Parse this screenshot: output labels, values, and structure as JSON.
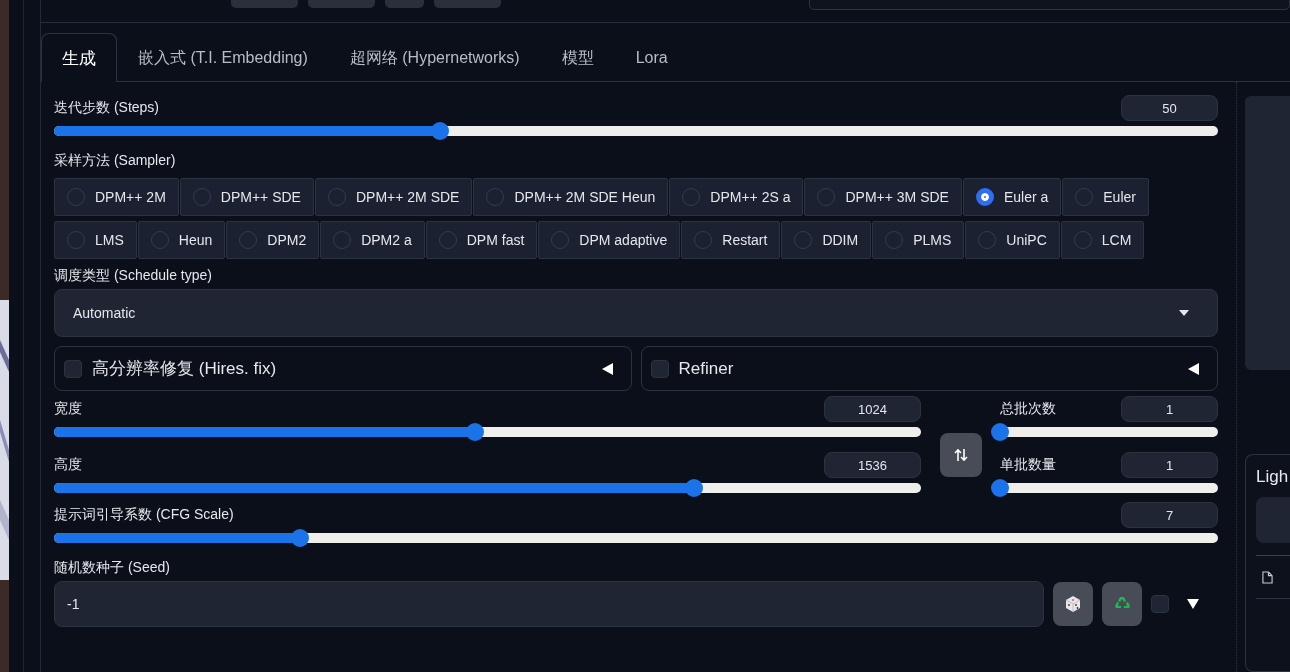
{
  "tabs": [
    {
      "label": "生成",
      "selected": true
    },
    {
      "label": "嵌入式 (T.I. Embedding)",
      "selected": false
    },
    {
      "label": "超网络 (Hypernetworks)",
      "selected": false
    },
    {
      "label": "模型",
      "selected": false
    },
    {
      "label": "Lora",
      "selected": false
    }
  ],
  "steps": {
    "label": "迭代步数 (Steps)",
    "value": "50",
    "level": 0.332
  },
  "sampler": {
    "label": "采样方法 (Sampler)",
    "options": [
      {
        "label": "DPM++ 2M",
        "selected": false
      },
      {
        "label": "DPM++ SDE",
        "selected": false
      },
      {
        "label": "DPM++ 2M SDE",
        "selected": false
      },
      {
        "label": "DPM++ 2M SDE Heun",
        "selected": false
      },
      {
        "label": "DPM++ 2S a",
        "selected": false
      },
      {
        "label": "DPM++ 3M SDE",
        "selected": false
      },
      {
        "label": "Euler a",
        "selected": true
      },
      {
        "label": "Euler",
        "selected": false
      },
      {
        "label": "LMS",
        "selected": false
      },
      {
        "label": "Heun",
        "selected": false
      },
      {
        "label": "DPM2",
        "selected": false
      },
      {
        "label": "DPM2 a",
        "selected": false
      },
      {
        "label": "DPM fast",
        "selected": false
      },
      {
        "label": "DPM adaptive",
        "selected": false
      },
      {
        "label": "Restart",
        "selected": false
      },
      {
        "label": "DDIM",
        "selected": false
      },
      {
        "label": "PLMS",
        "selected": false
      },
      {
        "label": "UniPC",
        "selected": false
      },
      {
        "label": "LCM",
        "selected": false
      }
    ]
  },
  "schedule_type": {
    "label": "调度类型 (Schedule type)",
    "value": "Automatic"
  },
  "accordions": [
    {
      "label": "高分辨率修复 (Hires. fix)",
      "checked": false,
      "expanded": false
    },
    {
      "label": "Refiner",
      "checked": false,
      "expanded": false
    }
  ],
  "width": {
    "label": "宽度",
    "value": "1024",
    "level": 0.486
  },
  "height": {
    "label": "高度",
    "value": "1536",
    "level": 0.738
  },
  "batch_count": {
    "label": "总批次数",
    "value": "1",
    "level": 0
  },
  "batch_size": {
    "label": "单批数量",
    "value": "1",
    "level": 0
  },
  "cfg_scale": {
    "label": "提示词引导系数 (CFG Scale)",
    "value": "7",
    "level": 0.211
  },
  "seed": {
    "label": "随机数种子 (Seed)",
    "value": "-1",
    "extra_checked": false
  },
  "side_card": {
    "title": "Ligh"
  }
}
